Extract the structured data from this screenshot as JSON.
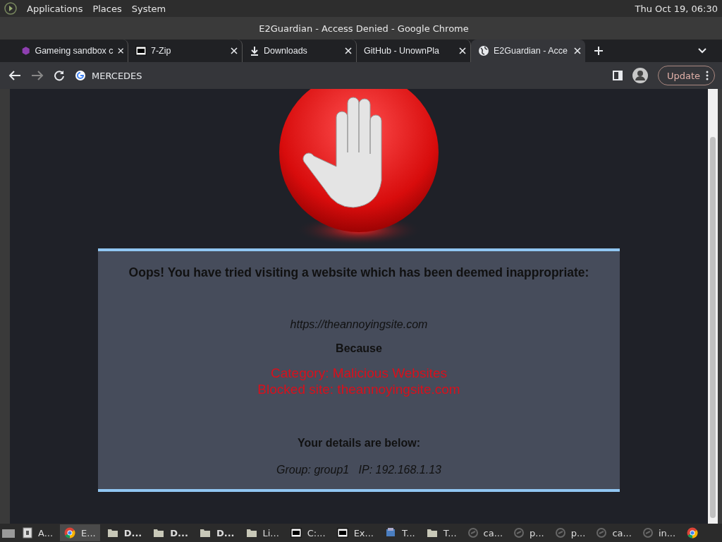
{
  "top_panel": {
    "menus": [
      "Applications",
      "Places",
      "System"
    ],
    "clock": "Thu Oct 19, 06:30"
  },
  "window": {
    "title": "E2Guardian - Access Denied - Google Chrome"
  },
  "tabs": [
    {
      "kind": "cube",
      "label": "Gameing sandbox c",
      "selected": false
    },
    {
      "kind": "sevenzip",
      "label": "7-Zip",
      "selected": false
    },
    {
      "kind": "download",
      "label": "Downloads",
      "selected": false
    },
    {
      "kind": "none",
      "label": "GitHub - UnownPla",
      "selected": false
    },
    {
      "kind": "globe",
      "label": "E2Guardian - Acce",
      "selected": true
    }
  ],
  "address_bar": {
    "value": "MERCEDES"
  },
  "update_button": "Update",
  "page": {
    "heading": "Oops! You have tried visiting a website which has been deemed inappropriate:",
    "url": "https://theannoyingsite.com",
    "because": "Because",
    "reasons": [
      "Category: Malicious Websites",
      "Blocked site: theannoyingsite.com"
    ],
    "details_heading": "Your details are below:",
    "details": "Group: group1   IP: 192.168.1.13"
  },
  "taskbar": [
    {
      "kind": "window",
      "label": "A...",
      "selected": false
    },
    {
      "kind": "chrome",
      "label": "E...",
      "selected": true
    },
    {
      "kind": "folder",
      "label": "D...",
      "selected": false
    },
    {
      "kind": "folder",
      "label": "D...",
      "selected": false
    },
    {
      "kind": "folder",
      "label": "D...",
      "selected": false
    },
    {
      "kind": "folder",
      "label": "Li...",
      "selected": false
    },
    {
      "kind": "sevenzip",
      "label": "C:...",
      "selected": false
    },
    {
      "kind": "sevenzip",
      "label": "Ex...",
      "selected": false
    },
    {
      "kind": "network",
      "label": "T...",
      "selected": false
    },
    {
      "kind": "folder",
      "label": "T...",
      "selected": false
    },
    {
      "kind": "generic",
      "label": "ca...",
      "selected": false
    },
    {
      "kind": "generic",
      "label": "p...",
      "selected": false
    },
    {
      "kind": "generic",
      "label": "p...",
      "selected": false
    },
    {
      "kind": "generic",
      "label": "ca...",
      "selected": false
    },
    {
      "kind": "generic",
      "label": "in...",
      "selected": false
    },
    {
      "kind": "chrome",
      "selected": false
    }
  ]
}
